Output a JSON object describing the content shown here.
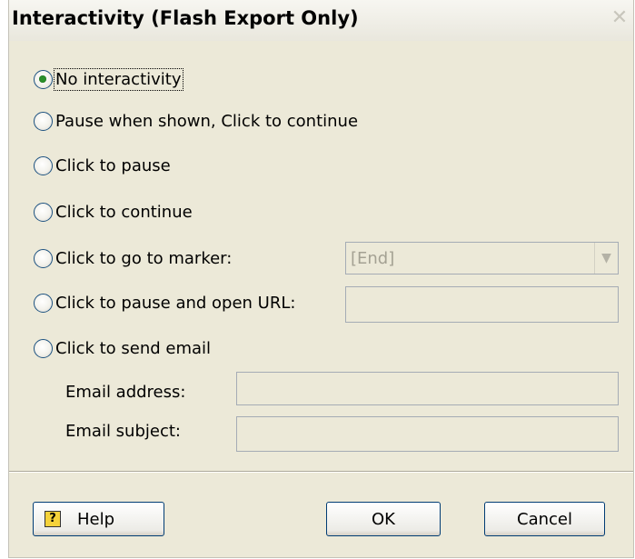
{
  "dialog": {
    "title": "Interactivity (Flash Export Only)",
    "close_glyph": "✕"
  },
  "options": {
    "no_interactivity": "No interactivity",
    "pause_click_continue": "Pause when shown, Click to continue",
    "click_to_pause": "Click to pause",
    "click_to_continue": "Click to continue",
    "click_go_to_marker": "Click to go to marker:",
    "click_pause_open_url": "Click to pause and open URL:",
    "click_send_email": "Click to send email",
    "selected": "No interactivity"
  },
  "marker": {
    "value": "[End]"
  },
  "url": {
    "value": ""
  },
  "email": {
    "address_label": "Email address:",
    "address_value": "",
    "subject_label": "Email subject:",
    "subject_value": ""
  },
  "buttons": {
    "help": "Help",
    "help_icon_glyph": "?",
    "ok": "OK",
    "cancel": "Cancel"
  },
  "colors": {
    "dialog_bg": "#ece9d8",
    "radio_border": "#1c5180",
    "radio_dot": "#2a8f2a",
    "button_border": "#003c74"
  }
}
